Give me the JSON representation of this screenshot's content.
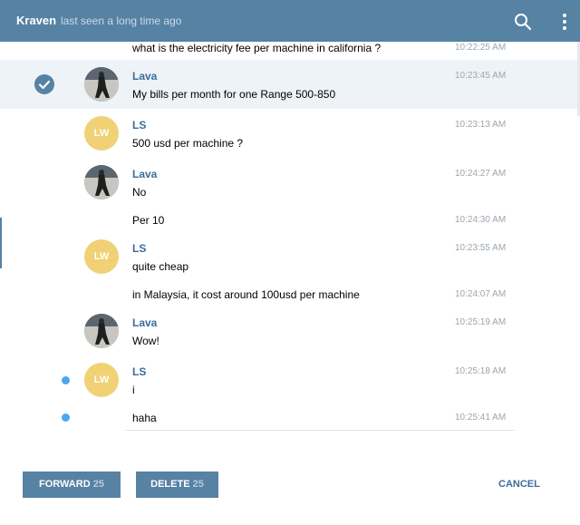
{
  "header": {
    "name": "Kraven",
    "status": "last seen a long time ago",
    "search_icon": "search-icon",
    "more_icon": "more-vertical-icon"
  },
  "colors": {
    "header_bg": "#5682a3",
    "selected_row": "#eef3f8",
    "sender_name": "#3a6d99",
    "lw_avatar": "#f0d175",
    "unread_dot": "#4aa7f0"
  },
  "messages": [
    {
      "sender": "",
      "avatar": "",
      "text": "what is the electricity fee per machine in california ?",
      "time": "10:22:25 AM",
      "selected": false,
      "unread": false
    },
    {
      "sender": "Lava",
      "avatar": "photo",
      "text": "My bills per month for one Range 500-850",
      "time": "10:23:45 AM",
      "selected": true,
      "unread": false
    },
    {
      "sender": "LS",
      "avatar": "LW",
      "text": "500 usd per machine ?",
      "time": "10:23:13 AM",
      "selected": false,
      "unread": false
    },
    {
      "sender": "Lava",
      "avatar": "photo",
      "text": "No",
      "time": "10:24:27 AM",
      "selected": false,
      "unread": false
    },
    {
      "sender": "",
      "avatar": "",
      "text": "Per 10",
      "time": "10:24:30 AM",
      "selected": false,
      "unread": false
    },
    {
      "sender": "LS",
      "avatar": "LW",
      "text": "quite cheap",
      "time": "10:23:55 AM",
      "selected": false,
      "unread": false
    },
    {
      "sender": "",
      "avatar": "",
      "text": "in Malaysia, it cost around 100usd per machine",
      "time": "10:24:07 AM",
      "selected": false,
      "unread": false
    },
    {
      "sender": "Lava",
      "avatar": "photo",
      "text": "Wow!",
      "time": "10:25:19 AM",
      "selected": false,
      "unread": false
    },
    {
      "sender": "LS",
      "avatar": "LW",
      "text": "i",
      "time": "10:25:18 AM",
      "selected": false,
      "unread": true
    },
    {
      "sender": "",
      "avatar": "",
      "text": "haha",
      "time": "10:25:41 AM",
      "selected": false,
      "unread": true
    }
  ],
  "footer": {
    "forward_label": "FORWARD",
    "forward_count": "25",
    "delete_label": "DELETE",
    "delete_count": "25",
    "cancel_label": "CANCEL"
  }
}
